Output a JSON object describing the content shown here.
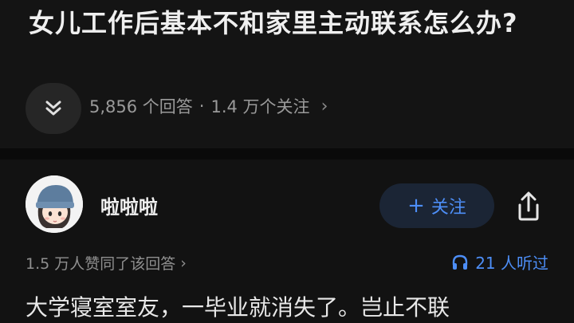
{
  "question": {
    "title": "女儿工作后基本不和家里主动联系怎么办?",
    "answer_count": "5,856 个回答",
    "separator": "·",
    "follower_count": "1.4 万个关注",
    "meta_chevron": "›"
  },
  "answer": {
    "author_name": "啦啦啦",
    "follow_plus": "+",
    "follow_label": "关注",
    "upvote_text": "1.5 万人赞同了该回答",
    "upvote_chevron": "›",
    "listen_text": "21 人听过",
    "excerpt": "大学寝室室友，一毕业就消失了。岂止不联"
  },
  "colors": {
    "background": "#121212",
    "accent_blue": "#4d8ef7",
    "follow_bg": "#1b2535",
    "muted_text": "#9a9a9a"
  },
  "icons": {
    "expand": "chevron-double-down-icon",
    "share": "share-icon",
    "listen": "headphones-icon",
    "avatar": "avatar-beanie-girl"
  }
}
